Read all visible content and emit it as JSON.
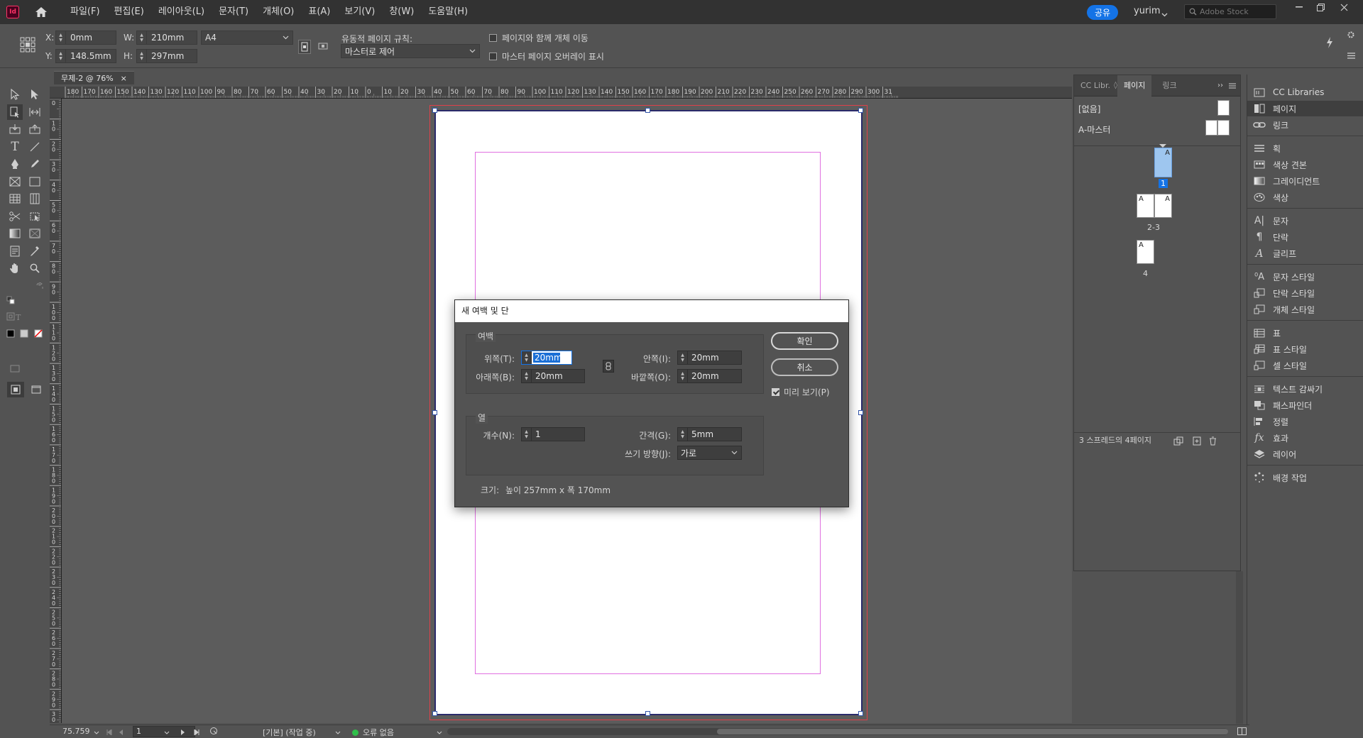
{
  "app": {
    "logo": "Id",
    "share_label": "공유",
    "user_name": "yurim",
    "stock_placeholder": "Adobe Stock"
  },
  "menus": [
    "파일(F)",
    "편집(E)",
    "레이아웃(L)",
    "문자(T)",
    "개체(O)",
    "표(A)",
    "보기(V)",
    "창(W)",
    "도움말(H)"
  ],
  "control_bar": {
    "x_label": "X:",
    "x_value": "0mm",
    "y_label": "Y:",
    "y_value": "148.5mm",
    "w_label": "W:",
    "w_value": "210mm",
    "h_label": "H:",
    "h_value": "297mm",
    "page_size": "A4",
    "liquid_rule_label": "유동적 페이지 규칙:",
    "liquid_rule_value": "마스터로 제어",
    "move_objects_label": "페이지와 함께 개체 이동",
    "master_overlay_label": "마스터 페이지 오버레이 표시"
  },
  "document_tab": {
    "title": "무제-2 @ 76%",
    "close": "×"
  },
  "ruler": {
    "h_labels": [
      "180",
      "170",
      "160",
      "150",
      "140",
      "130",
      "120",
      "110",
      "100",
      "90",
      "80",
      "70",
      "60",
      "50",
      "40",
      "30",
      "20",
      "10",
      "0",
      "10",
      "20",
      "30",
      "40",
      "50",
      "60",
      "70",
      "80",
      "90",
      "100",
      "110",
      "120",
      "130",
      "140",
      "150",
      "160",
      "170",
      "180",
      "190",
      "200",
      "210",
      "220",
      "230",
      "240",
      "250",
      "260",
      "270",
      "280",
      "290",
      "300",
      "31"
    ],
    "v_labels": [
      "0",
      "1 0",
      "2 0",
      "3 0",
      "4 0",
      "5 0",
      "6 0",
      "7 0",
      "8 0",
      "9 0",
      "1 0 0",
      "1 1 0",
      "1 2 0",
      "1 3 0",
      "1 4 0",
      "1 5 0",
      "1 6 0",
      "1 7 0",
      "1 8 0",
      "1 9 0",
      "2 0 0",
      "2 1 0",
      "2 2 0",
      "2 3 0",
      "2 4 0",
      "2 5 0",
      "2 6 0",
      "2 7 0",
      "2 8 0",
      "2 9 0",
      "3 0 0"
    ]
  },
  "dialog": {
    "title": "새 여백 및 단",
    "margins_group": "여백",
    "top_label": "위쪽(T):",
    "top_value": "20mm",
    "bottom_label": "아래쪽(B):",
    "bottom_value": "20mm",
    "inside_label": "안쪽(I):",
    "inside_value": "20mm",
    "outside_label": "바깥쪽(O):",
    "outside_value": "20mm",
    "columns_group": "열",
    "count_label": "개수(N):",
    "count_value": "1",
    "gutter_label": "간격(G):",
    "gutter_value": "5mm",
    "direction_label": "쓰기 방향(J):",
    "direction_value": "가로",
    "ok_label": "확인",
    "cancel_label": "취소",
    "preview_label": "미리 보기(P)",
    "size_label": "크기:",
    "size_value": "높이 257mm x 폭 170mm"
  },
  "pages_panel": {
    "tabs": [
      "CC Libr.",
      "페이지",
      "링크"
    ],
    "none_master": "[없음]",
    "a_master": "A-마스터",
    "page_1_num": "1",
    "spread_2_3_num": "2-3",
    "page_4_num": "4",
    "master_letter": "A",
    "footer": "3 스프레드의 4페이지"
  },
  "dock": {
    "items": [
      "CC Libraries",
      "페이지",
      "링크",
      "획",
      "색상 견본",
      "그레이디언트",
      "색상",
      "문자",
      "단락",
      "글리프",
      "문자 스타일",
      "단락 스타일",
      "개체 스타일",
      "표",
      "표 스타일",
      "셀 스타일",
      "텍스트 감싸기",
      "패스파인더",
      "정렬",
      "효과",
      "레이어",
      "배경 작업"
    ]
  },
  "status_bar": {
    "zoom": "75.759",
    "page": "1",
    "profile": "[기본] (작업 중)",
    "errors": "오류 없음"
  },
  "colors": {
    "accent": "#1473e6",
    "bleed": "#e0404a",
    "margin": "#e070e0",
    "error_ok": "#2fbf4a"
  }
}
